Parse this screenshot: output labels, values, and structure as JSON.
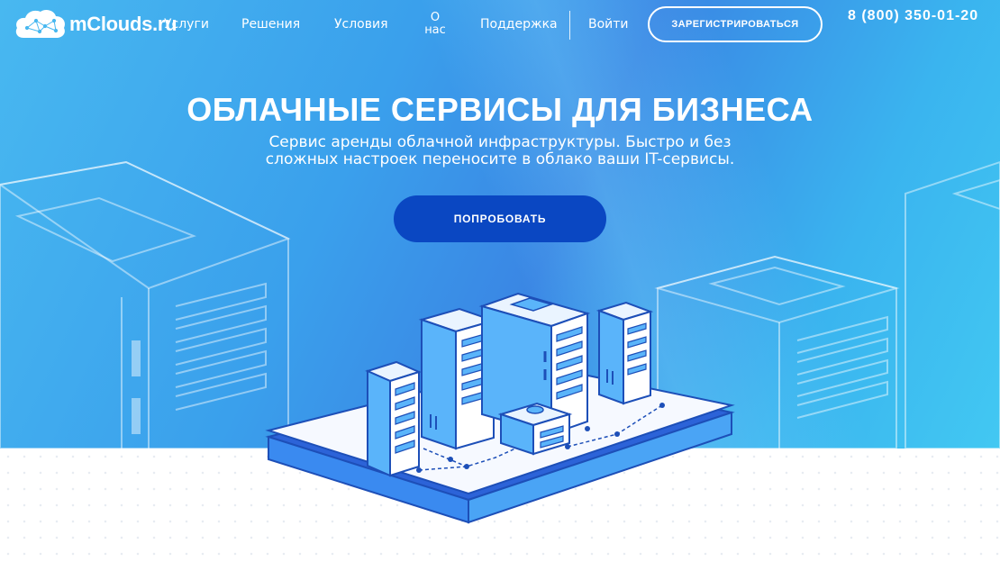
{
  "header": {
    "logo_text": "mClouds.ru",
    "nav": [
      {
        "label": "Услуги"
      },
      {
        "label": "Решения"
      },
      {
        "label": "Условия"
      },
      {
        "label": "О нас"
      },
      {
        "label": "Поддержка"
      }
    ],
    "about_line1": "О",
    "about_line2": "нас",
    "login_label": "Войти",
    "register_label": "ЗАРЕГИСТРИРОВАТЬСЯ",
    "phone": "8 (800) 350-01-20"
  },
  "hero": {
    "title": "ОБЛАЧНЫЕ СЕРВИСЫ ДЛЯ БИЗНЕСА",
    "subtitle_line1": "Сервис аренды облачной инфраструктуры. Быстро и без",
    "subtitle_line2": "сложных настроек переносите в облако ваши IT-сервисы.",
    "cta_label": "ПОПРОБОВАТЬ"
  },
  "colors": {
    "hero_gradient_start": "#48b8f0",
    "hero_gradient_mid": "#3a86e4",
    "cta_background": "#0a47c2",
    "text_on_hero": "#ffffff"
  }
}
